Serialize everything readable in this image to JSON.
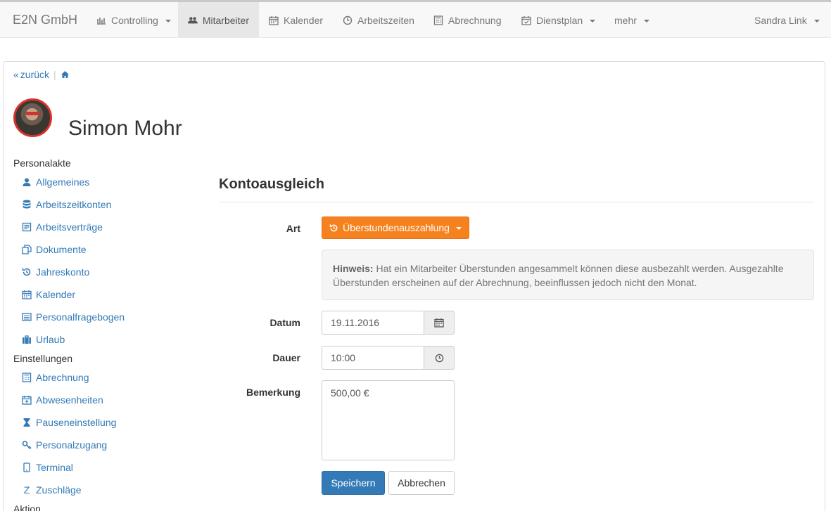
{
  "nav": {
    "brand": "E2N GmbH",
    "items": [
      {
        "label": "Controlling",
        "icon": "bar-chart-icon",
        "dropdown": true
      },
      {
        "label": "Mitarbeiter",
        "icon": "users-icon",
        "active": true
      },
      {
        "label": "Kalender",
        "icon": "calendar-icon"
      },
      {
        "label": "Arbeitszeiten",
        "icon": "clock-icon"
      },
      {
        "label": "Abrechnung",
        "icon": "calculator-icon"
      },
      {
        "label": "Dienstplan",
        "icon": "calendar-check-icon",
        "dropdown": true
      },
      {
        "label": "mehr",
        "dropdown": true
      }
    ],
    "user": "Sandra Link"
  },
  "breadcrumb": {
    "back": "zurück"
  },
  "employee": {
    "name": "Simon Mohr"
  },
  "sidebar": {
    "personalakte": {
      "title": "Personalakte",
      "items": [
        {
          "label": "Allgemeines",
          "icon": "user-icon"
        },
        {
          "label": "Arbeitszeitkonten",
          "icon": "database-icon"
        },
        {
          "label": "Arbeitsverträge",
          "icon": "contract-icon"
        },
        {
          "label": "Dokumente",
          "icon": "documents-icon"
        },
        {
          "label": "Jahreskonto",
          "icon": "history-icon"
        },
        {
          "label": "Kalender",
          "icon": "calendar-icon"
        },
        {
          "label": "Personalfragebogen",
          "icon": "list-icon"
        },
        {
          "label": "Urlaub",
          "icon": "suitcase-icon"
        }
      ]
    },
    "einstellungen": {
      "title": "Einstellungen",
      "items": [
        {
          "label": "Abrechnung",
          "icon": "calculator-icon"
        },
        {
          "label": "Abwesenheiten",
          "icon": "calendar-plus-icon"
        },
        {
          "label": "Pauseneinstellung",
          "icon": "hourglass-icon"
        },
        {
          "label": "Personalzugang",
          "icon": "key-icon"
        },
        {
          "label": "Terminal",
          "icon": "tablet-icon"
        },
        {
          "label": "Zuschläge",
          "icon": "z-icon"
        }
      ]
    },
    "aktion": {
      "title": "Aktion"
    }
  },
  "form": {
    "title": "Kontoausgleich",
    "art_label": "Art",
    "art_value": "Überstundenauszahlung",
    "hint_label": "Hinweis:",
    "hint_text": " Hat ein Mitarbeiter Überstunden angesammelt können diese ausbezahlt werden. Ausgezahlte Überstunden erscheinen auf der Abrechnung, beeinflussen jedoch nicht den Monat.",
    "datum_label": "Datum",
    "datum_value": "19.11.2016",
    "dauer_label": "Dauer",
    "dauer_value": "10:00",
    "bemerkung_label": "Bemerkung",
    "bemerkung_value": "500,00 €",
    "save_label": "Speichern",
    "cancel_label": "Abbrechen"
  },
  "colors": {
    "accent": "#337ab7",
    "art_button": "#f5821f",
    "avatar_ring": "#d9342b"
  }
}
